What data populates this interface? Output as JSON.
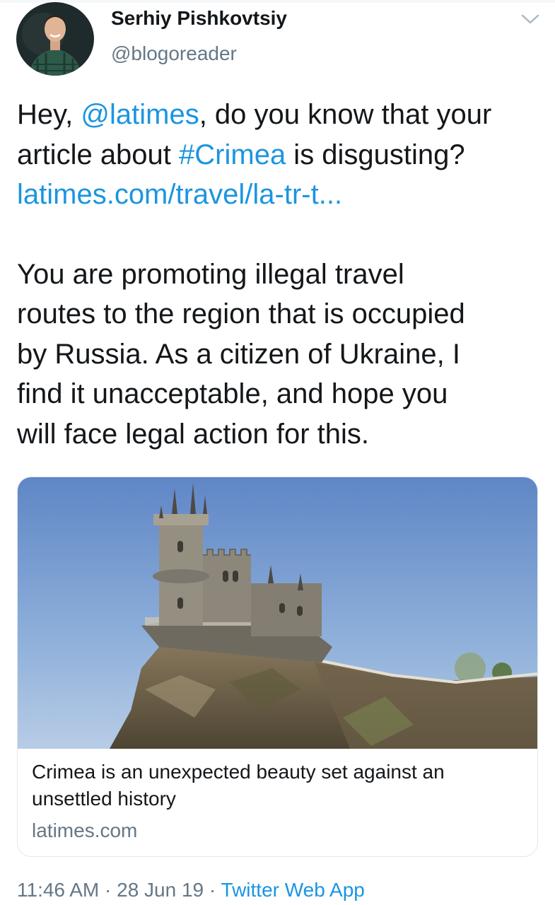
{
  "author": {
    "display_name": "Serhiy Pishkovtsiy",
    "handle": "@blogoreader"
  },
  "tweet": {
    "line1_pre": "Hey, ",
    "line1_mention": "@latimes",
    "line1_post": ", do you know that your",
    "line2_pre": "article about ",
    "line2_hashtag": "#Crimea",
    "line2_post": " is disgusting?",
    "line3_link": "latimes.com/travel/la-tr-t...",
    "para2": [
      "You are promoting illegal travel",
      "routes to the region that is occupied",
      "by Russia. As a citizen of Ukraine, I",
      "find it unacceptable, and hope you",
      "will face legal action for this."
    ]
  },
  "card": {
    "title_line1": "Crimea is an unexpected beauty set against an",
    "title_line2": "unsettled history",
    "domain": "latimes.com"
  },
  "meta": {
    "time": "11:46 AM",
    "sep1": " · ",
    "date": "28 Jun 19",
    "sep2": " · ",
    "source": "Twitter Web App"
  },
  "icons": {
    "menu": "chevron-down-icon"
  },
  "colors": {
    "link": "#1b95e0",
    "text": "#14171a",
    "secondary": "#657786",
    "border": "#e1e8ed"
  }
}
